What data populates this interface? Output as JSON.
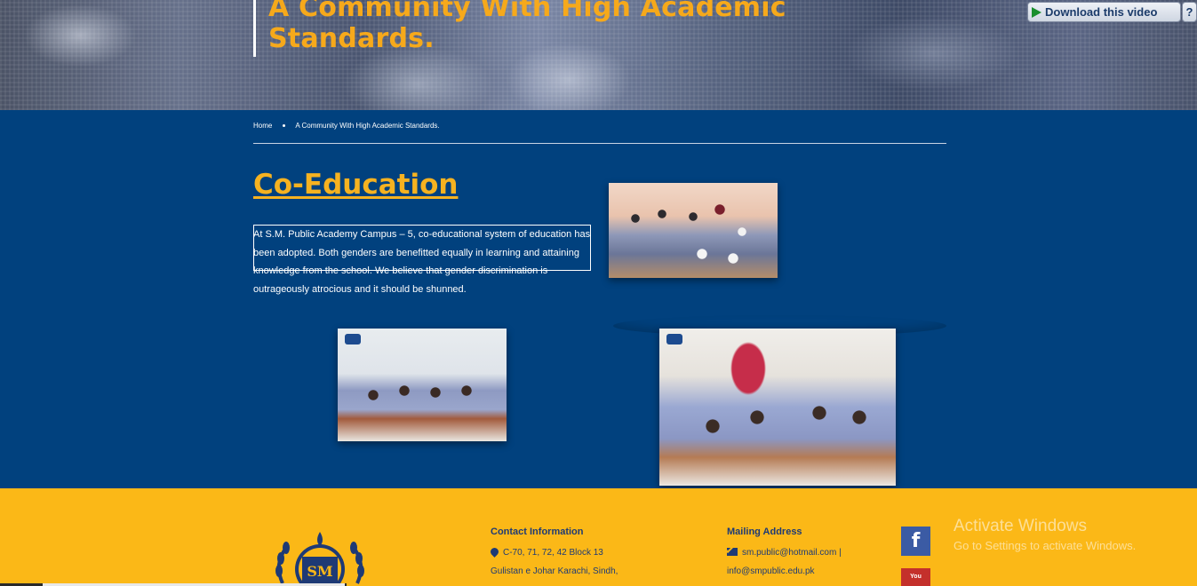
{
  "hero": {
    "title_line1": "A Community With High Academic",
    "title_line2": "Standards."
  },
  "browser_addon": {
    "download_label": "Download this video",
    "help_label": "?"
  },
  "breadcrumb": {
    "home": "Home",
    "current": "A Community With High Academic Standards."
  },
  "section": {
    "title": "Co-Education",
    "paragraph": "At S.M. Public Academy Campus – 5, co-educational system of education has been adopted. Both genders are benefitted equally in learning and attaining knowledge from the school. We believe that gender discrimination is outrageously atrocious and it should be shunned."
  },
  "footer": {
    "contact_title": "Contact Information",
    "contact_line1": "C-70, 71, 72, 42 Block 13",
    "contact_line2": "Gulistan e Johar Karachi, Sindh,",
    "mail_title": "Mailing Address",
    "mail_line1": "sm.public@hotmail.com |",
    "mail_line2": "info@smpublic.edu.pk",
    "logo_text": "SM",
    "facebook_label": "f",
    "youtube_label": "You"
  },
  "windows_watermark": {
    "title": "Activate Windows",
    "subtitle": "Go to Settings to activate Windows."
  },
  "colors": {
    "background": "#01417e",
    "accent": "#f6a91b",
    "footer": "#fbb817",
    "footer_text": "#1e3a75"
  }
}
